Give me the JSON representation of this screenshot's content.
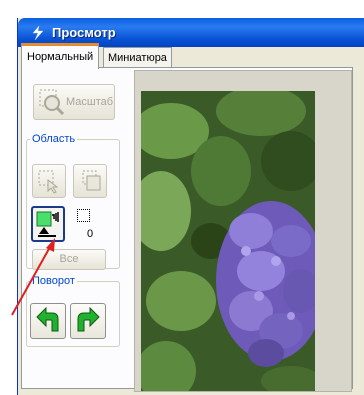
{
  "window": {
    "title": "Просмотр"
  },
  "tabs": [
    {
      "label": "Нормальный",
      "active": true
    },
    {
      "label": "Миниатюра",
      "active": false
    }
  ],
  "tools": {
    "zoom_label": "Масштаб",
    "area_group_title": "Область",
    "selection_count": "0",
    "all_label": "Все",
    "rotate_group_title": "Поворот"
  },
  "icons": {
    "title": "scanner-app-icon",
    "zoom": "zoom-magnifier-icon",
    "select_area_1": "select-area-icon",
    "select_area_2": "select-area-copy-icon",
    "auto_select": "auto-select-icon",
    "rotate_left": "rotate-left-icon",
    "rotate_right": "rotate-right-icon"
  },
  "colors": {
    "titlebar": "#0a55d6",
    "group_title": "#0046d5",
    "rotate_arrow": "#1fa82c",
    "annotation_arrow": "#e02020"
  }
}
